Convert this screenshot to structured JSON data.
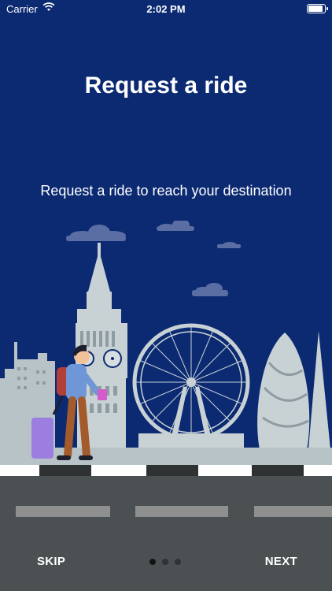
{
  "status": {
    "carrier": "Carrier",
    "time": "2:02 PM",
    "battery_level": 1.0
  },
  "onboarding": {
    "title": "Request a ride",
    "subtitle": "Request a ride to reach your destination",
    "skip_label": "SKIP",
    "next_label": "NEXT",
    "page_count": 3,
    "current_page": 1
  },
  "colors": {
    "background": "#0b2a72",
    "skyline": "#b7c3c6",
    "road": "#4b5152"
  },
  "icons": {
    "wifi": "wifi-icon",
    "battery": "battery-icon"
  }
}
